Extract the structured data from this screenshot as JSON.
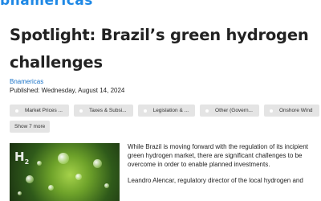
{
  "site": {
    "logo_text": "bnamericas"
  },
  "article": {
    "title": "Spotlight: Brazil’s green hydrogen challenges",
    "source": "Bnamericas",
    "published": "Published: Wednesday, August 14, 2024",
    "paragraphs": [
      "While Brazil is moving forward with the regulation of its incipient green hydrogen market, there are significant challenges to be overcome in order to enable planned investments.",
      "Leandro Alencar, regulatory director of the local hydrogen and"
    ]
  },
  "tags": [
    "Market Prices ...",
    "Taxes & Subsi...",
    "Legislation & ...",
    "Other (Govern...",
    "Onshore Wind"
  ],
  "show_more_label": "Show 7 more",
  "hero_image": {
    "overlay_text": "H2",
    "colors": {
      "leaf": "#6ea22a",
      "dark": "#1a2f10"
    }
  },
  "colors": {
    "link": "#1a73c8",
    "brand": "#1e88e5",
    "tag_bg": "#e4e4e4"
  }
}
